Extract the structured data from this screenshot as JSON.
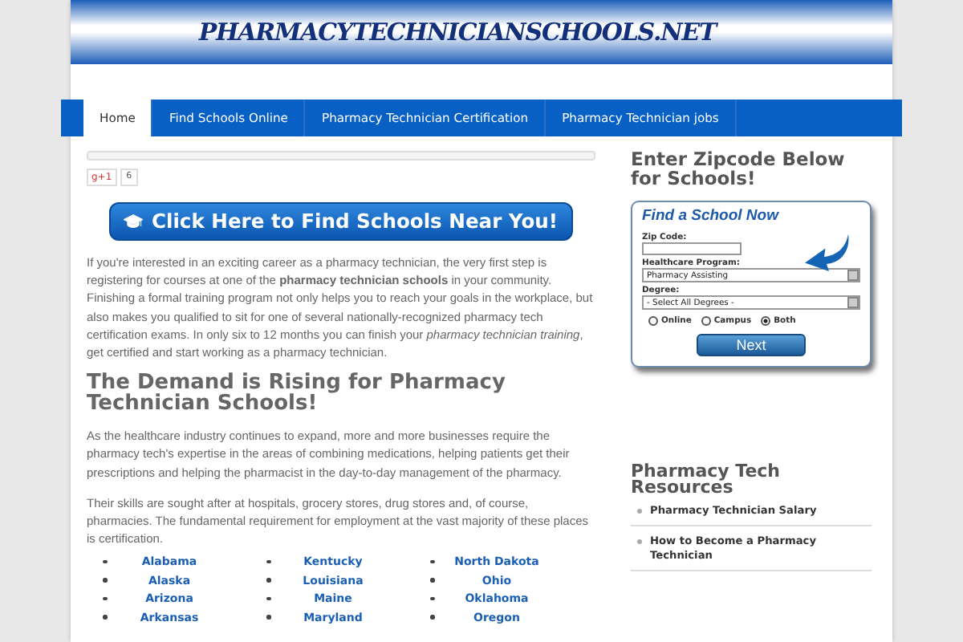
{
  "header": {
    "title": "PHARMACYTECHNICIANSCHOOLS.NET"
  },
  "nav": [
    {
      "label": "Home",
      "selected": true
    },
    {
      "label": "Find Schools Online",
      "selected": false
    },
    {
      "label": "Pharmacy Technician Certification",
      "selected": false
    },
    {
      "label": "Pharmacy Technician jobs",
      "selected": false
    }
  ],
  "share": {
    "label": "g+1",
    "count": "6"
  },
  "cta": {
    "label": "Click Here to Find Schools Near You!"
  },
  "intro": "If you're interested in an exciting career as a pharmacy technician, the very first step is registering for courses at one of the **pharmacy technician schools** in your community. Finishing a formal training program not only helps you to reach your goals in the workplace, but also makes you qualified to sit for one of several nationally-recognized pharmacy tech certification exams. In only six to 12 months you can finish your *pharmacy technician training*, get certified and start working as a pharmacy technician.",
  "heading": "The Demand is Rising for Pharmacy Technician Schools!",
  "paragraphs": [
    "As the healthcare industry continues to expand, more and more businesses require the pharmacy tech's expertise in the areas of combining medications, helping patients get their prescriptions and helping the pharmacist in the day-to-day management of the pharmacy.",
    "Their skills are sought after at hospitals, grocery stores, drug stores and, of course, pharmacies. The fundamental requirement for employment at the vast majority of these places is certification."
  ],
  "states": [
    [
      "Alabama",
      "Alaska",
      "Arizona",
      "Arkansas"
    ],
    [
      "Kentucky",
      "Louisiana",
      "Maine",
      "Maryland"
    ],
    [
      "North Dakota",
      "Ohio",
      "Oklahoma",
      "Oregon"
    ]
  ],
  "sidebar": {
    "heading": "Enter Zipcode Below for Schools!",
    "form": {
      "title": "Find a School Now",
      "zip_label": "Zip Code:",
      "program_label": "Healthcare Program:",
      "program_value": "Pharmacy Assisting",
      "degree_label": "Degree:",
      "degree_value": "- Select All Degrees -",
      "radios": [
        {
          "label": "Online",
          "selected": false
        },
        {
          "label": "Campus",
          "selected": false
        },
        {
          "label": "Both",
          "selected": true
        }
      ],
      "button": "Next"
    },
    "resources_heading": "Pharmacy Tech Resources",
    "resources": [
      "Pharmacy Technician Salary",
      "How to Become a Pharmacy Technician"
    ]
  }
}
